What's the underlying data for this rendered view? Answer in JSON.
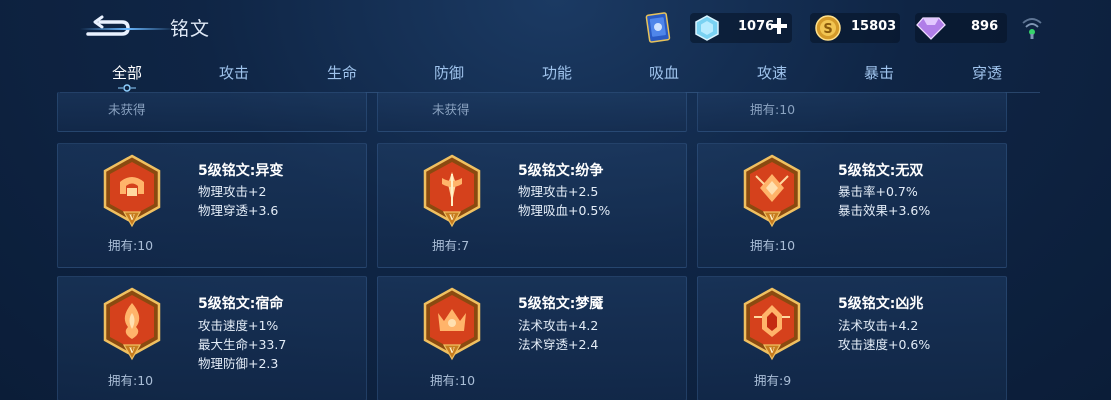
{
  "header": {
    "title": "铭文",
    "resources": [
      {
        "name": "diamond",
        "icon": "diamond-icon",
        "value": "1076"
      },
      {
        "name": "gold",
        "icon": "gold-coin-icon",
        "value": "15803"
      },
      {
        "name": "gem",
        "icon": "gem-icon",
        "value": "896"
      }
    ]
  },
  "tabs": [
    {
      "label": "全部",
      "active": true
    },
    {
      "label": "攻击"
    },
    {
      "label": "生命"
    },
    {
      "label": "防御"
    },
    {
      "label": "功能"
    },
    {
      "label": "吸血"
    },
    {
      "label": "攻速"
    },
    {
      "label": "暴击"
    },
    {
      "label": "穿透"
    }
  ],
  "partial_cards": [
    {
      "owned": "未获得"
    },
    {
      "owned": "未获得"
    },
    {
      "owned": "拥有:10"
    }
  ],
  "cards": [
    {
      "name": "5级铭文:异变",
      "stats": [
        "物理攻击+2",
        "物理穿透+3.6"
      ],
      "owned": "拥有:10"
    },
    {
      "name": "5级铭文:纷争",
      "stats": [
        "物理攻击+2.5",
        "物理吸血+0.5%"
      ],
      "owned": "拥有:7"
    },
    {
      "name": "5级铭文:无双",
      "stats": [
        "暴击率+0.7%",
        "暴击效果+3.6%"
      ],
      "owned": "拥有:10"
    },
    {
      "name": "5级铭文:宿命",
      "stats": [
        "攻击速度+1%",
        "最大生命+33.7",
        "物理防御+2.3"
      ],
      "owned": "拥有:10"
    },
    {
      "name": "5级铭文:梦魇",
      "stats": [
        "法术攻击+4.2",
        "法术穿透+2.4"
      ],
      "owned": "拥有:10"
    },
    {
      "name": "5级铭文:凶兆",
      "stats": [
        "法术攻击+4.2",
        "攻击速度+0.6%"
      ],
      "owned": "拥有:9"
    }
  ],
  "colors": {
    "emblem_red": "#d5411c",
    "emblem_gold": "#e9b04a",
    "tab_active": "#ffffff",
    "tab_inactive": "#9fc3ec"
  }
}
